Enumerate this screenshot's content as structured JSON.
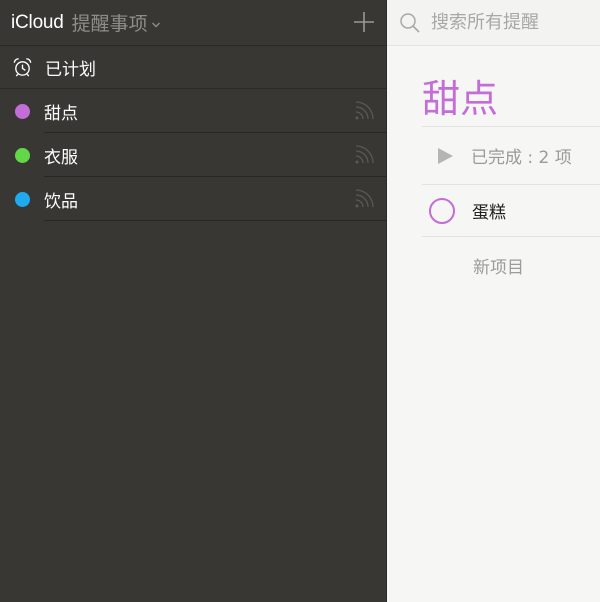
{
  "colors": {
    "sidebar_bg": "#383734",
    "accent_purple": "#c36dd6",
    "list_colors": [
      "#c36dd6",
      "#62d847",
      "#1fa9ef"
    ]
  },
  "sidebar": {
    "account": "iCloud",
    "app_name": "提醒事项",
    "add_icon": "plus-icon",
    "scheduled": {
      "icon": "alarm-clock-icon",
      "label": "已计划"
    },
    "lists": [
      {
        "label": "甜点",
        "color": "#c36dd6",
        "shared_icon": "share-broadcast-icon"
      },
      {
        "label": "衣服",
        "color": "#62d847",
        "shared_icon": "share-broadcast-icon"
      },
      {
        "label": "饮品",
        "color": "#1fa9ef",
        "shared_icon": "share-broadcast-icon"
      }
    ]
  },
  "main": {
    "search": {
      "placeholder": "搜索所有提醒",
      "value": ""
    },
    "title": "甜点",
    "completed": {
      "label": "已完成 : 2 项"
    },
    "reminders": [
      {
        "text": "蛋糕"
      }
    ],
    "new_item_placeholder": "新项目"
  }
}
